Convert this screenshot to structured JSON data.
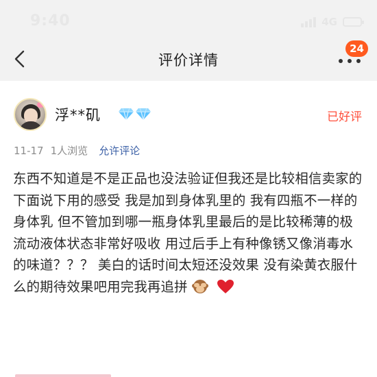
{
  "status_bar": {
    "time": "9:40",
    "network": "4G"
  },
  "nav": {
    "title": "评价详情",
    "badge_count": "24"
  },
  "review": {
    "username": "浮**矶",
    "rating_tag": "已好评",
    "date": "11-17",
    "views": "1人浏览",
    "allow_comment": "允许评论",
    "text": "东西不知道是不是正品也没法验证但我还是比较相信卖家的下面说下用的感受  我是加到身体乳里的  我有四瓶不一样的身体乳 但不管加到哪一瓶身体乳里最后的是比较稀薄的极流动液体状态非常好吸收  用过后手上有种像锈又像消毒水的味道？？？  美白的话时间太短还没效果 没有染黄衣服什么的期待效果吧用完我再追拼"
  },
  "icons": {
    "back": "chevron-left-icon",
    "more": "more-dots-icon",
    "level": "diamond-icon",
    "emoji_1": "see-no-evil-monkey-emoji",
    "emoji_2": "red-heart-emoji"
  },
  "colors": {
    "badge": "#ff5a1f",
    "rating_tag": "#ff4f3b",
    "link": "#3f63a8",
    "diamond": "#4fb4ff"
  }
}
